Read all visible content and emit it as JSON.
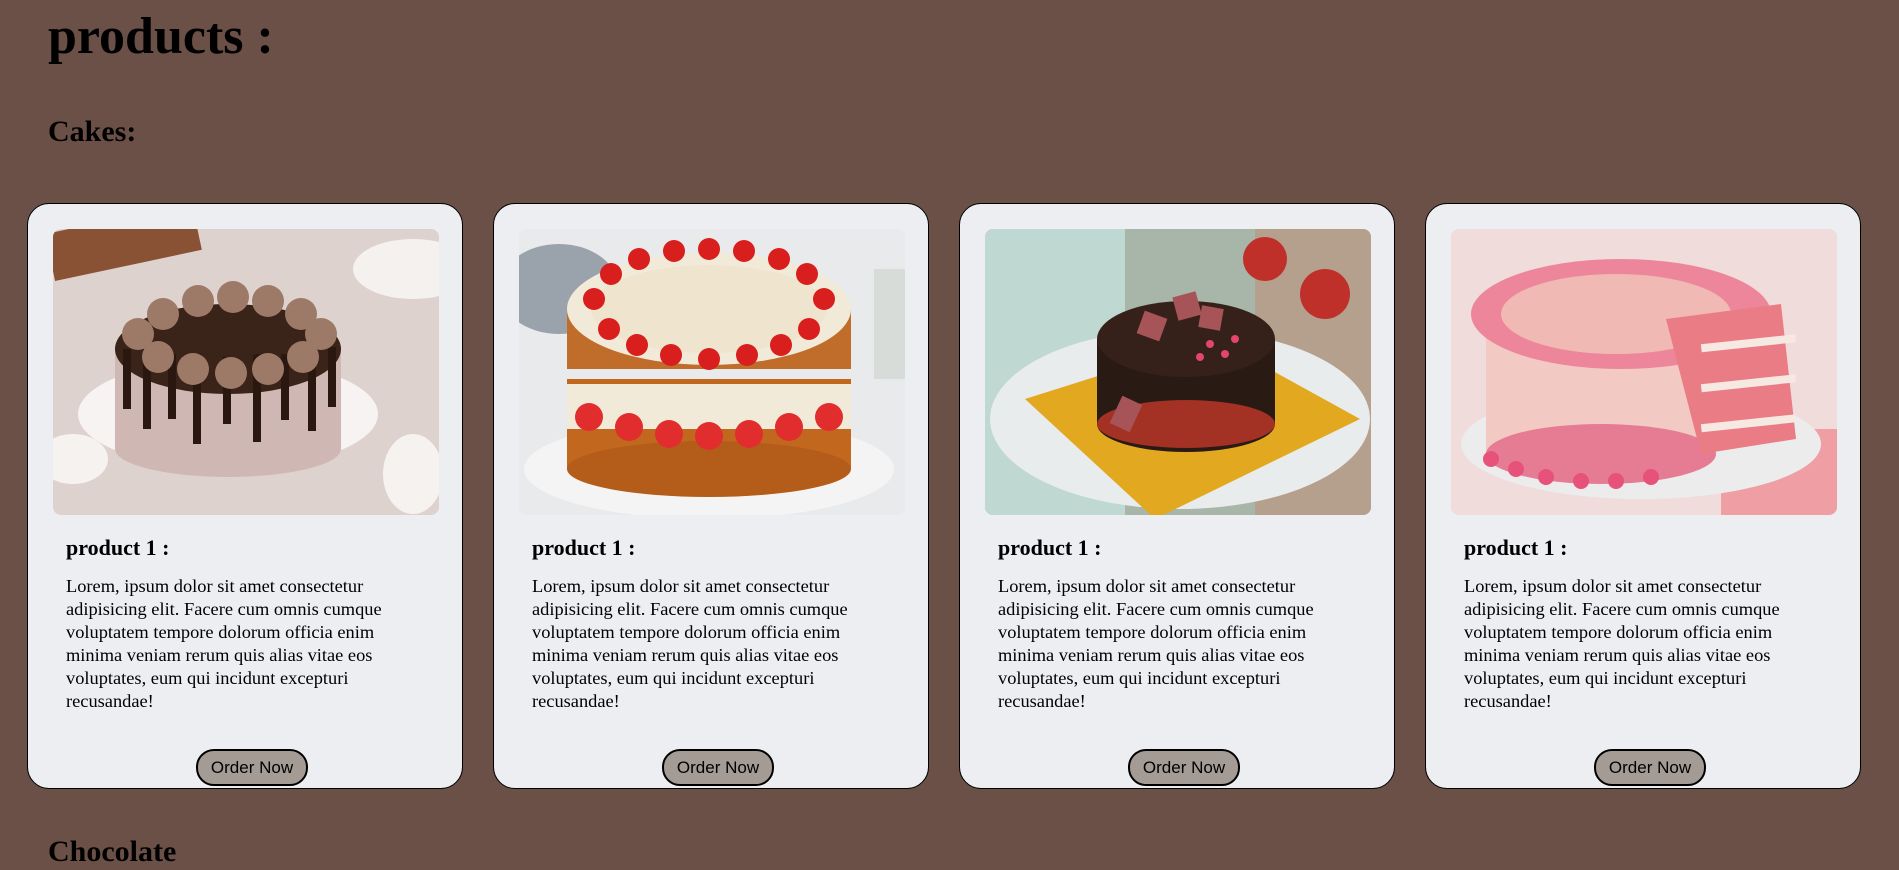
{
  "page": {
    "title": "products :",
    "section_cakes": "Cakes:",
    "section_next": "Chocolate"
  },
  "cards": [
    {
      "title": "product 1 :",
      "text": "Lorem, ipsum dolor sit amet consectetur adipisicing elit. Facere cum omnis cumque voluptatem tempore dolorum officia enim minima veniam rerum quis alias vitae eos voluptates, eum qui incidunt excepturi recusandae!",
      "button": "Order Now",
      "image": "chocolate-drip-cake-image"
    },
    {
      "title": "product 1 :",
      "text": "Lorem, ipsum dolor sit amet consectetur adipisicing elit. Facere cum omnis cumque voluptatem tempore dolorum officia enim minima veniam rerum quis alias vitae eos voluptates, eum qui incidunt excepturi recusandae!",
      "button": "Order Now",
      "image": "strawberry-cake-image"
    },
    {
      "title": "product 1 :",
      "text": "Lorem, ipsum dolor sit amet consectetur adipisicing elit. Facere cum omnis cumque voluptatem tempore dolorum officia enim minima veniam rerum quis alias vitae eos voluptates, eum qui incidunt excepturi recusandae!",
      "button": "Order Now",
      "image": "dark-chocolate-cake-image"
    },
    {
      "title": "product 1 :",
      "text": "Lorem, ipsum dolor sit amet consectetur adipisicing elit. Facere cum omnis cumque voluptatem tempore dolorum officia enim minima veniam rerum quis alias vitae eos voluptates, eum qui incidunt excepturi recusandae!",
      "button": "Order Now",
      "image": "pink-layer-cake-image"
    }
  ],
  "colors": {
    "background": "#6a5046",
    "card": "#eceef2",
    "button": "#a59b95"
  }
}
